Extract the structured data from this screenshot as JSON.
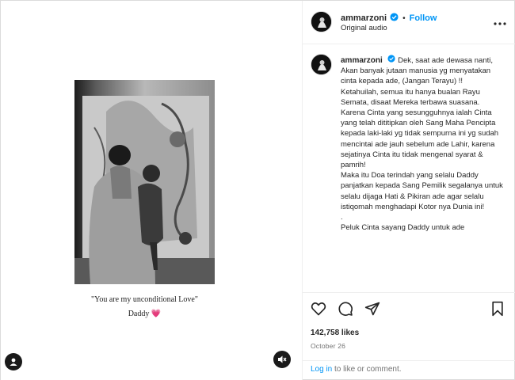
{
  "post": {
    "image": {
      "caption_line1": "\"You are my unconditional Love\"",
      "caption_line2": "Daddy",
      "heart": "💗"
    }
  },
  "header": {
    "username": "ammarzoni",
    "separator": "•",
    "follow_label": "Follow",
    "audio": "Original audio"
  },
  "comment": {
    "username": "ammarzoni",
    "lines": [
      "Dek, saat ade dewasa nanti, Akan banyak jutaan manusia yg menyatakan cinta kepada ade, (Jangan Terayu) !!",
      "Ketahuilah, semua itu hanya bualan Rayu Semata, disaat Mereka terbawa suasana.",
      "Karena Cinta yang sesungguhnya ialah Cinta yang telah dititipkan oleh Sang Maha Pencipta kepada laki-laki yg tidak sempurna ini yg sudah mencintai ade jauh sebelum ade Lahir, karena sejatinya Cinta itu tidak mengenal syarat & pamrih!",
      "Maka itu Doa terindah yang selalu Daddy panjatkan kepada Sang Pemilik segalanya untuk selalu dijaga Hati & Pikiran ade agar selalu istiqomah menghadapi Kotor nya Dunia ini!",
      ".",
      "Peluk Cinta sayang Daddy untuk ade"
    ]
  },
  "stats": {
    "likes": "142,758 likes",
    "date": "October 26"
  },
  "login": {
    "link": "Log in",
    "text": " to like or comment."
  },
  "colors": {
    "accent": "#0095f6",
    "text": "#262626",
    "muted": "#737373"
  },
  "icons": [
    "user-tag-icon",
    "mute-icon",
    "verified-icon",
    "more-icon",
    "heart-icon",
    "comment-icon",
    "share-icon",
    "bookmark-icon"
  ]
}
